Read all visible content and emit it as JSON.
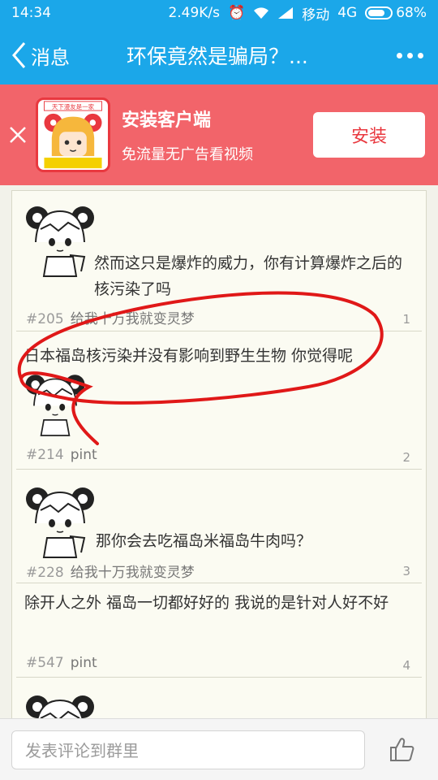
{
  "status_bar": {
    "time": "14:34",
    "network_speed": "2.49K/s",
    "carrier": "移动",
    "network_type": "4G",
    "battery": "68%"
  },
  "nav": {
    "back_label": "消息",
    "title": "环保竟然是骗局？...",
    "more_icon": "more-dots-icon"
  },
  "banner": {
    "title": "安装客户端",
    "subtitle": "免流量无广告看视频",
    "install_label": "安装",
    "background": "#f2646a",
    "app_icon_caption": "天下漫友是一家"
  },
  "posts": [
    {
      "text": "然而这只是爆炸的威力，你有计算爆炸之后的核污染了吗",
      "num": "#205",
      "user": "给我十万我就变灵梦",
      "floor": "1"
    },
    {
      "text": "日本福岛核污染并没有影响到野生生物  你觉得呢",
      "num": "#214",
      "user": "pint",
      "floor": "2"
    },
    {
      "text": "那你会去吃福岛米福岛牛肉吗？",
      "num": "#228",
      "user": "给我十万我就变灵梦",
      "floor": "3"
    },
    {
      "text": "除开人之外 福岛一切都好好的 我说的是针对人好不好",
      "num": "#547",
      "user": "pint",
      "floor": "4"
    }
  ],
  "comment_bar": {
    "placeholder": "发表评论到群里",
    "like_icon": "thumbs-up-icon"
  },
  "colors": {
    "accent": "#1ba7e9",
    "banner": "#f2646a",
    "annotation": "#e01818"
  }
}
